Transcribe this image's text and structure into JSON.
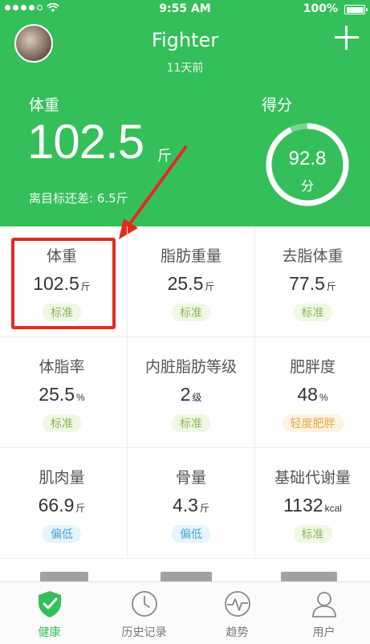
{
  "status_bar": {
    "time": "9:55 AM",
    "battery": "100%"
  },
  "header": {
    "nickname": "Fighter",
    "updated": "11天前",
    "weight_label": "体重",
    "weight_value": "102.5",
    "weight_unit": "斤",
    "target_text": "离目标还差: 6.5斤",
    "score_label": "得分",
    "score_value": "92.8",
    "score_unit": "分",
    "score_progress": 0.928
  },
  "metrics": [
    {
      "title": "体重",
      "value": "102.5",
      "unit": "斤",
      "status": "标准",
      "level": "ok"
    },
    {
      "title": "脂肪重量",
      "value": "25.5",
      "unit": "斤",
      "status": "标准",
      "level": "ok"
    },
    {
      "title": "去脂体重",
      "value": "77.5",
      "unit": "斤",
      "status": "标准",
      "level": "ok"
    },
    {
      "title": "体脂率",
      "value": "25.5",
      "unit": "%",
      "status": "标准",
      "level": "ok"
    },
    {
      "title": "内脏脂肪等级",
      "value": "2",
      "unit": "级",
      "status": "标准",
      "level": "ok"
    },
    {
      "title": "肥胖度",
      "value": "48",
      "unit": "%",
      "status": "轻度肥胖",
      "level": "warn"
    },
    {
      "title": "肌肉量",
      "value": "66.9",
      "unit": "斤",
      "status": "偏低",
      "level": "low"
    },
    {
      "title": "骨量",
      "value": "4.3",
      "unit": "斤",
      "status": "偏低",
      "level": "low"
    },
    {
      "title": "基础代谢量",
      "value": "1132",
      "unit": "kcal",
      "status": "标准",
      "level": "ok"
    }
  ],
  "tabs": [
    {
      "label": "健康",
      "icon": "shield-check-icon",
      "active": true
    },
    {
      "label": "历史记录",
      "icon": "clock-icon",
      "active": false
    },
    {
      "label": "趋势",
      "icon": "pulse-icon",
      "active": false
    },
    {
      "label": "用户",
      "icon": "user-icon",
      "active": false
    }
  ],
  "colors": {
    "brand_green": "#35bf5a",
    "highlight_red": "#e12b23"
  }
}
